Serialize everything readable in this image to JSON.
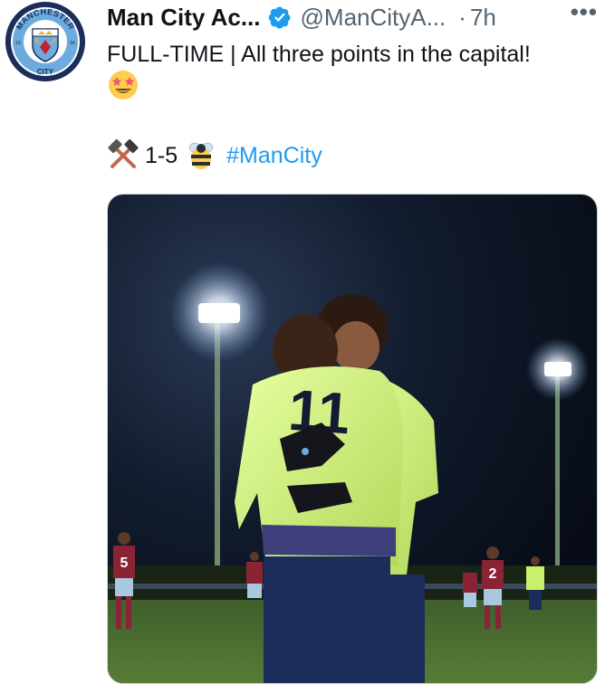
{
  "tweet": {
    "author_name": "Man City Ac...",
    "handle": "@ManCityA...",
    "separator": "·",
    "time": "7h",
    "more": "•••",
    "text_line1": "FULL-TIME | All three points in the capital!",
    "score": "1-5",
    "hashtag": "#ManCity"
  },
  "avatar": {
    "top_text": "MANCHESTER",
    "bottom_text": "CITY",
    "left_num": "18",
    "right_num": "94"
  },
  "colors": {
    "accent": "#1d9bf0",
    "crest_blue": "#1c2c5b",
    "sky_blue": "#6cabdd",
    "kit_green": "#c9f06a"
  },
  "media": {
    "shirt_number_back": "11",
    "shirt_number_bg": "2",
    "shirt_number_bg2": "5"
  }
}
